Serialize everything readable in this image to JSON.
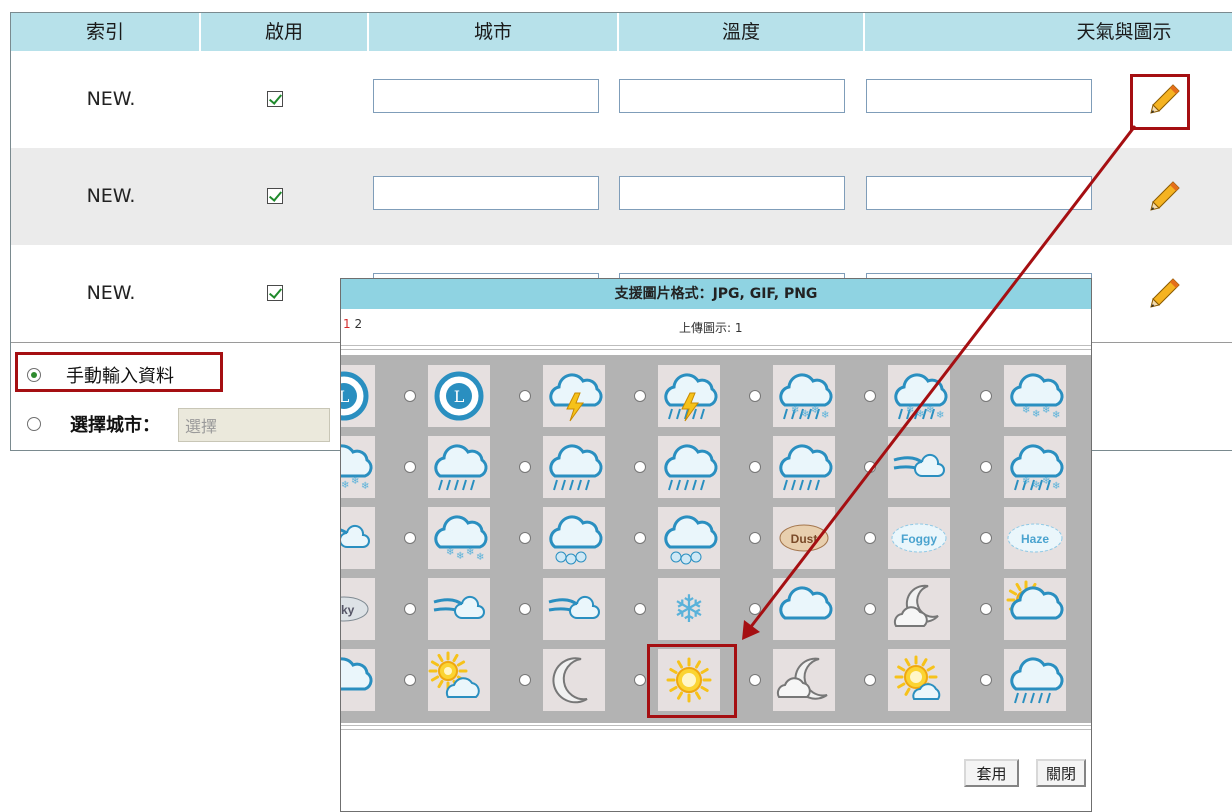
{
  "table": {
    "headers": {
      "index": "索引",
      "enable": "啟用",
      "city": "城市",
      "temperature": "溫度",
      "weather_icon": "天氣與圖示"
    },
    "rows": [
      {
        "index": "NEW.",
        "enabled": true,
        "city": "",
        "temperature": "",
        "weather": ""
      },
      {
        "index": "NEW.",
        "enabled": true,
        "city": "",
        "temperature": "",
        "weather": ""
      },
      {
        "index": "NEW.",
        "enabled": true,
        "city": "",
        "temperature": "",
        "weather": ""
      }
    ],
    "accent_color": "#b7e1ea",
    "alt_row_color": "#ebebeb"
  },
  "options": {
    "manual_label": "手動輸入資料",
    "select_city_label": "選擇城市：",
    "select_placeholder": "選擇",
    "selected": "manual"
  },
  "popup": {
    "title": "支援圖片格式：JPG, GIF, PNG",
    "pages": [
      "1",
      "2"
    ],
    "current_page": "1",
    "upload_info": "上傳圖示: 1",
    "apply_label": "套用",
    "close_label": "關閉",
    "header_color": "#8fd3e2",
    "highlight_color": "#a50f12",
    "icons": [
      [
        "typhoon-icon",
        "typhoon-icon",
        "thunderstorm-icon",
        "thunderstorm-rain-icon",
        "rain-snow-icon",
        "snow-rain-icon",
        "snow-icon"
      ],
      [
        "drizzle-icon",
        "light-rain-icon",
        "heavy-rain-icon",
        "rain-icon",
        "shower-icon",
        "blizzard-icon",
        "sleet-icon"
      ],
      [
        "snow-wind-icon",
        "snow-cloud-icon",
        "hail-icon",
        "hail-rain-icon",
        "dust-icon",
        "foggy-icon",
        "haze-icon"
      ],
      [
        "smoky-icon",
        "wind-icon",
        "windy-icon",
        "snowflake-icon",
        "cloudy-icon",
        "night-cloudy-icon",
        "partly-sunny-icon"
      ],
      [
        "partly-cloudy-icon",
        "sun-clouds-icon",
        "moon-icon",
        "sunny-icon",
        "moon-cloud-icon",
        "sun-cloud-icon",
        "storm-icon"
      ]
    ],
    "dust_text": "Dust",
    "foggy_text": "Foggy",
    "haze_text": "Haze",
    "smoky_text": "oky"
  }
}
